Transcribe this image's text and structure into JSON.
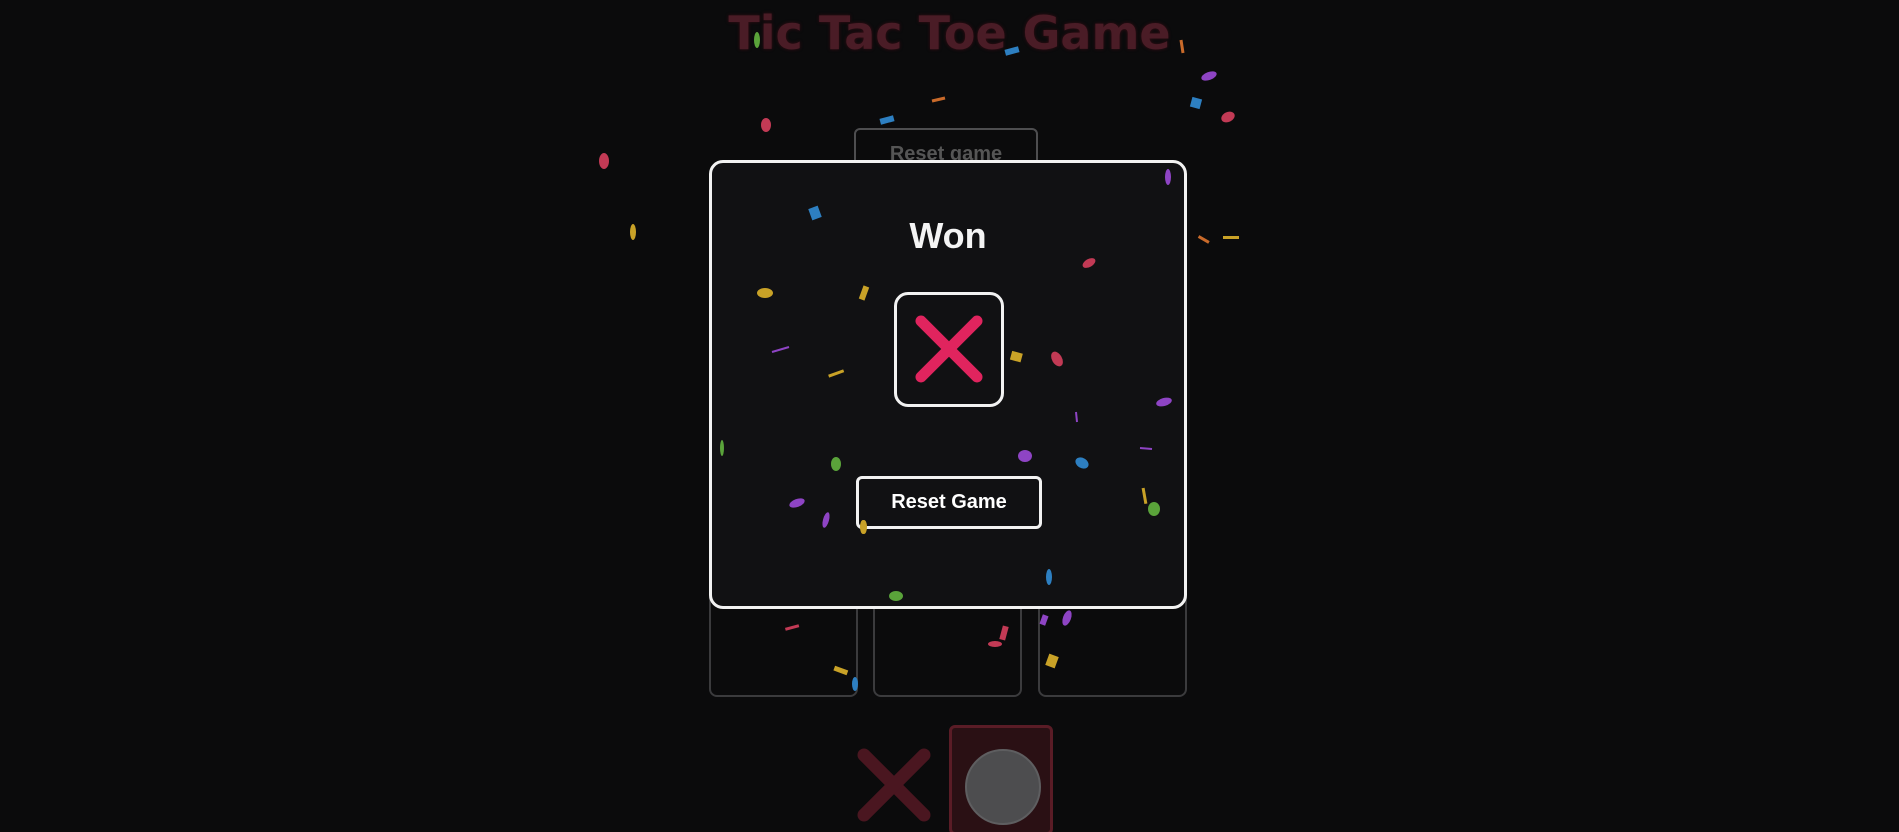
{
  "page": {
    "title": "Tic Tac Toe Game",
    "reset_label": "Reset game"
  },
  "board": {
    "visible_cells": [
      "",
      "",
      ""
    ]
  },
  "turn_indicator": {
    "marks": [
      "x",
      "o"
    ],
    "active": "o"
  },
  "modal": {
    "title": "Won",
    "winner_mark": "x",
    "reset_label": "Reset Game"
  },
  "colors": {
    "background": "#0b0b0c",
    "accent_x": "#e0245e",
    "modal_border": "#f2f2f2",
    "confetti": [
      "#c23a55",
      "#2d7fc1",
      "#8e44c4",
      "#c9a227",
      "#5aa33a",
      "#c96a2a"
    ]
  },
  "icons": {
    "winner": "x-mark-icon",
    "turn_x": "x-mark-icon",
    "turn_o": "circle-icon"
  }
}
